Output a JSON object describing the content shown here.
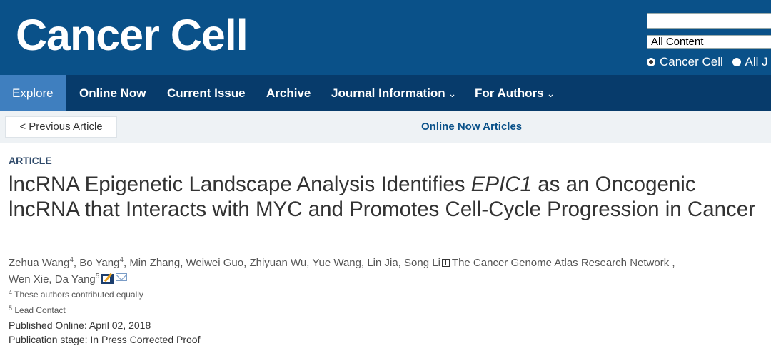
{
  "header": {
    "logo": "Cancer Cell",
    "search": {
      "value": "",
      "scope_selected": "All Content"
    },
    "radio_options": [
      {
        "label": "Cancer Cell",
        "checked": true
      },
      {
        "label": "All J",
        "checked": false
      }
    ]
  },
  "nav": {
    "items": [
      {
        "label": "Explore",
        "active": true
      },
      {
        "label": "Online Now"
      },
      {
        "label": "Current Issue"
      },
      {
        "label": "Archive"
      },
      {
        "label": "Journal Information",
        "caret": "⌄"
      },
      {
        "label": "For Authors",
        "caret": "⌄"
      }
    ]
  },
  "subbar": {
    "previous_label": "< Previous Article",
    "online_now_label": "Online Now Articles"
  },
  "article": {
    "type_label": "ARTICLE",
    "title_part1": "lncRNA Epigenetic Landscape Analysis Identifies ",
    "title_italic": "EPIC1",
    "title_part2": " as an Oncogenic lncRNA that Interacts with MYC and Promotes Cell-Cycle Progression in Cancer",
    "authors": [
      {
        "name": "Zehua Wang",
        "sup": "4"
      },
      {
        "name": "Bo Yang",
        "sup": "4"
      },
      {
        "name": "Min Zhang"
      },
      {
        "name": "Weiwei Guo"
      },
      {
        "name": "Zhiyuan Wu"
      },
      {
        "name": "Yue Wang"
      },
      {
        "name": "Lin Jia"
      },
      {
        "name": "Song Li"
      }
    ],
    "consortium": "The Cancer Genome Atlas Research Network ,",
    "authors_line2": [
      {
        "name": "Wen Xie"
      },
      {
        "name": "Da Yang",
        "sup": "5"
      }
    ],
    "footnotes": [
      {
        "sup": "4",
        "text": "These authors contributed equally"
      },
      {
        "sup": "5",
        "text": "Lead Contact"
      }
    ],
    "published_online": "Published Online: April 02, 2018",
    "publication_stage": "Publication stage: In Press Corrected Proof"
  },
  "colors": {
    "header_bg": "#0a5189",
    "nav_bg": "#073b6b",
    "nav_active_bg": "#3f7fbf",
    "subbar_bg": "#eef2f5",
    "link": "#0a5189"
  }
}
